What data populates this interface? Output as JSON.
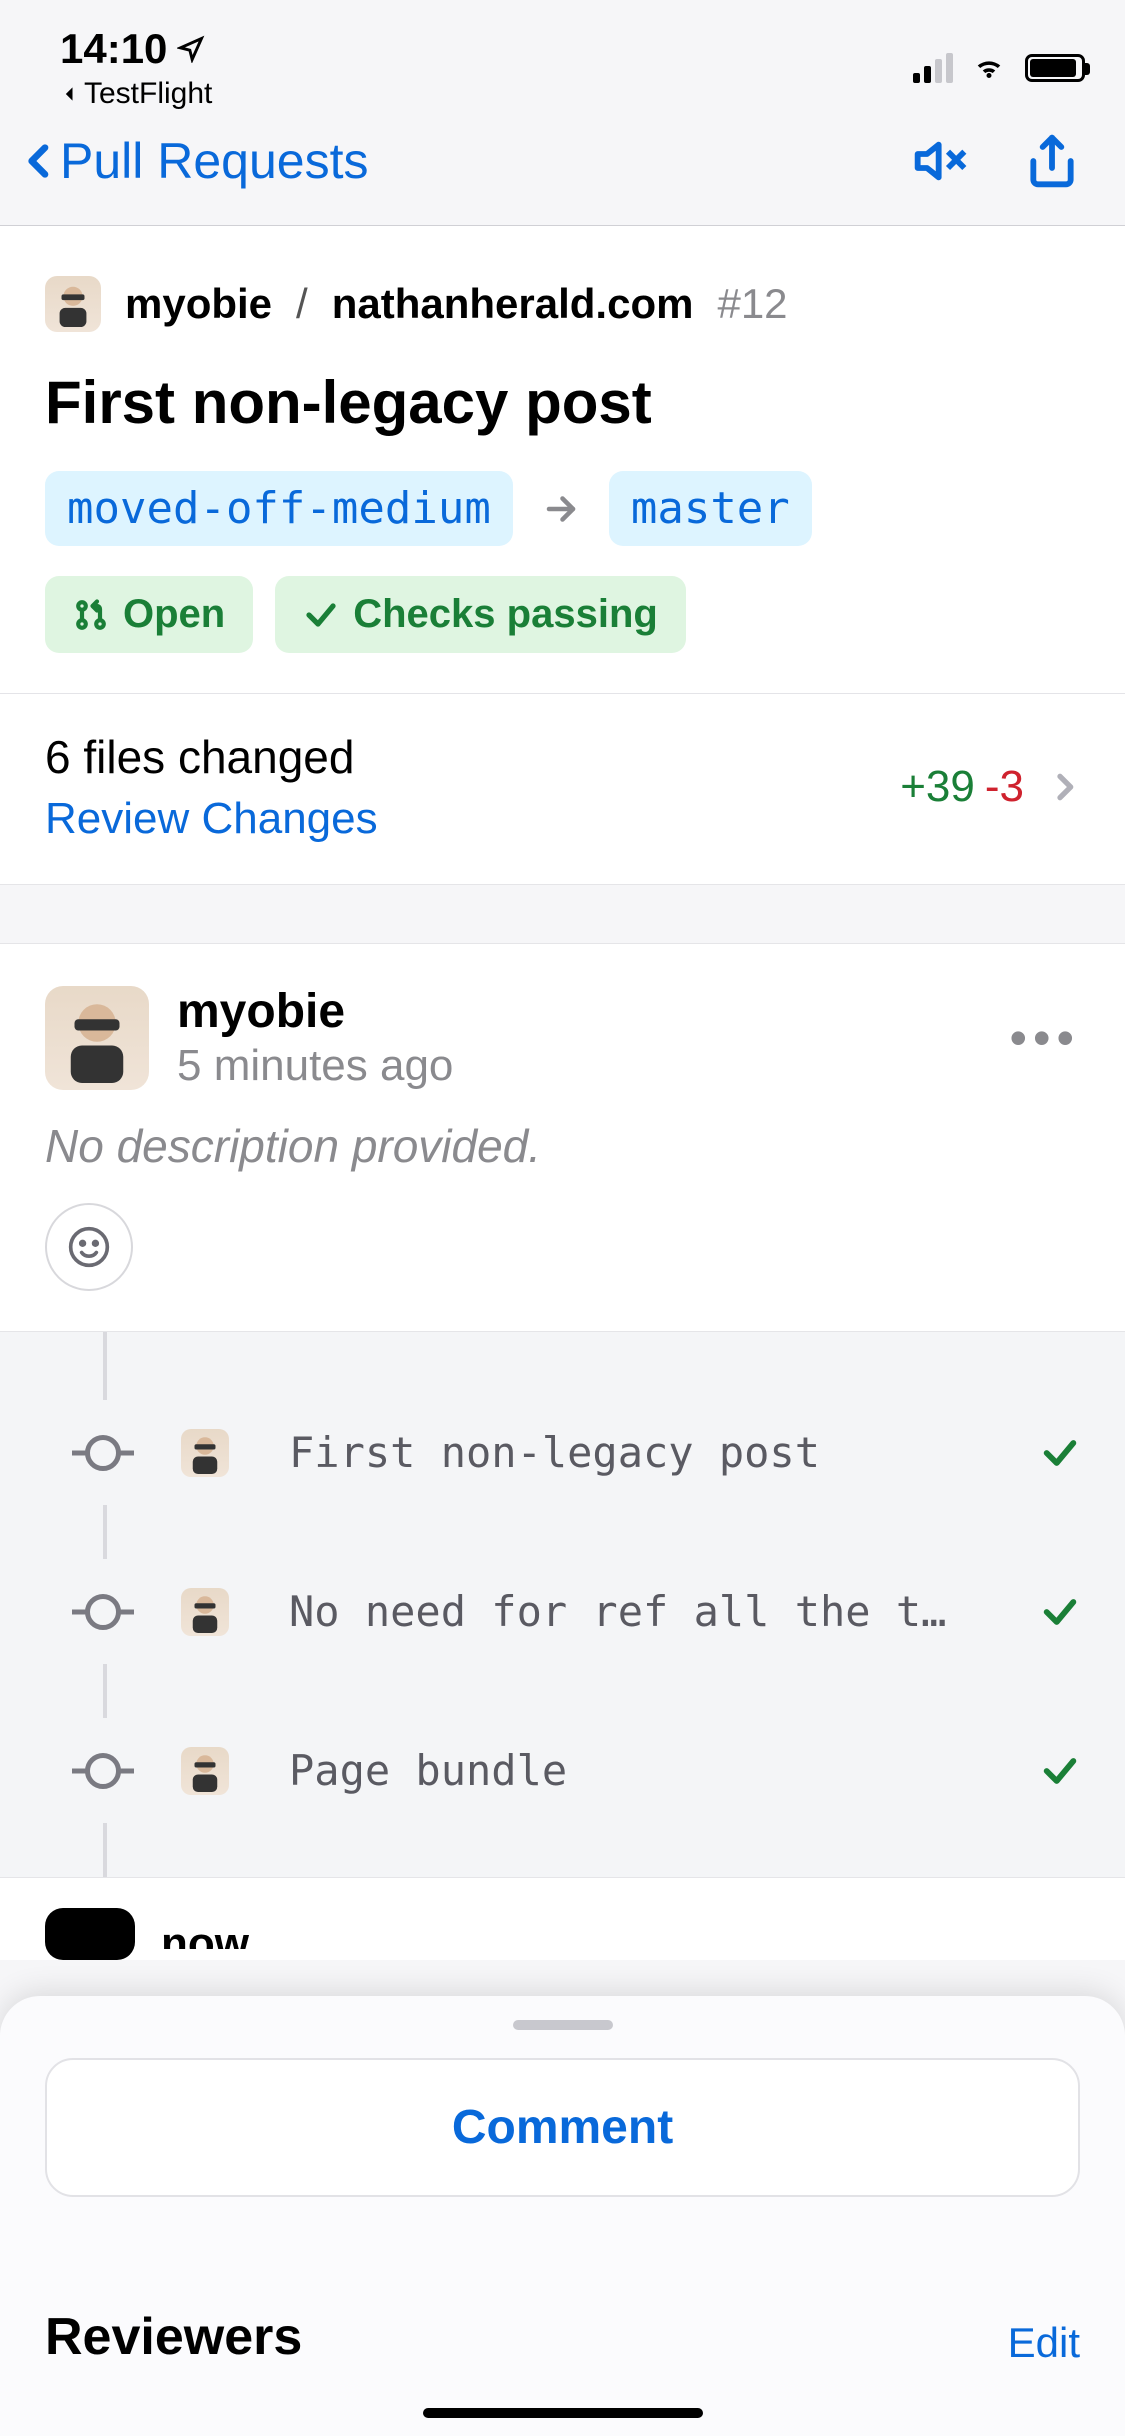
{
  "statusbar": {
    "time": "14:10",
    "back_app": "TestFlight"
  },
  "nav": {
    "back_label": "Pull Requests"
  },
  "pr": {
    "owner": "myobie",
    "repo": "nathanherald.com",
    "number": "#12",
    "title": "First non-legacy post",
    "source_branch": "moved-off-medium",
    "target_branch": "master",
    "state_label": "Open",
    "checks_label": "Checks passing",
    "files_changed_label": "6 files changed",
    "review_changes_label": "Review Changes",
    "additions": "+39",
    "deletions": "-3"
  },
  "description": {
    "author": "myobie",
    "time": "5 minutes ago",
    "body": "No description provided."
  },
  "commits": [
    {
      "message": "First non-legacy post"
    },
    {
      "message": "No need for ref all the t…"
    },
    {
      "message": "Page bundle"
    }
  ],
  "peek": {
    "label": "now"
  },
  "sheet": {
    "comment_label": "Comment",
    "reviewers_label": "Reviewers",
    "edit_label": "Edit"
  }
}
